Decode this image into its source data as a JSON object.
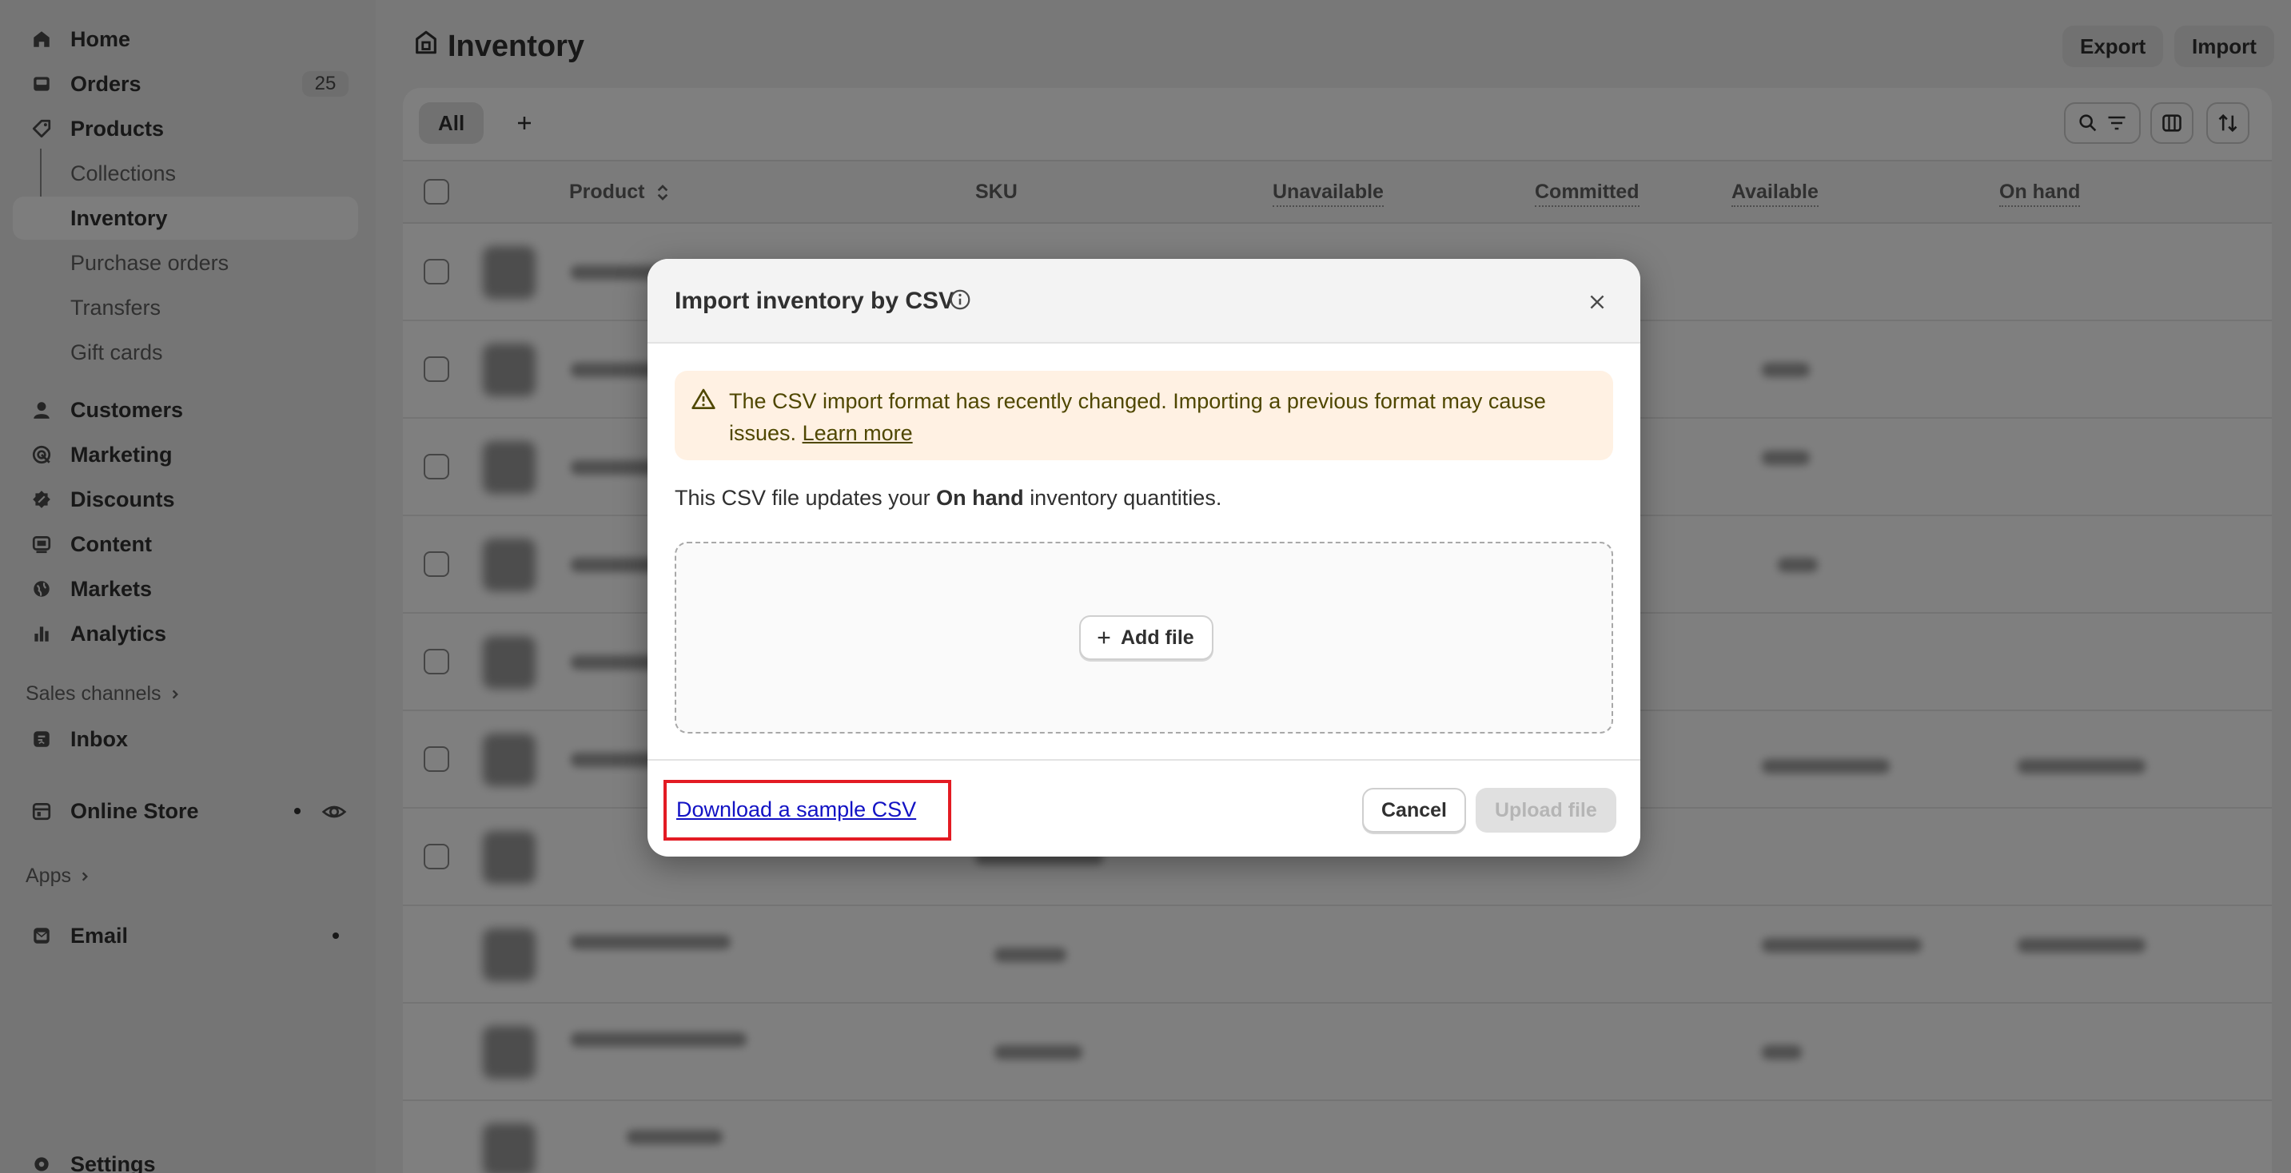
{
  "sidebar": {
    "items": [
      {
        "label": "Home",
        "icon": "home-icon"
      },
      {
        "label": "Orders",
        "icon": "inbox-tray-icon",
        "badge": "25"
      },
      {
        "label": "Products",
        "icon": "tag-icon"
      },
      {
        "label": "Collections"
      },
      {
        "label": "Inventory"
      },
      {
        "label": "Purchase orders"
      },
      {
        "label": "Transfers"
      },
      {
        "label": "Gift cards"
      },
      {
        "label": "Customers",
        "icon": "person-icon"
      },
      {
        "label": "Marketing",
        "icon": "target-icon"
      },
      {
        "label": "Discounts",
        "icon": "discount-icon"
      },
      {
        "label": "Content",
        "icon": "content-icon"
      },
      {
        "label": "Markets",
        "icon": "globe-icon"
      },
      {
        "label": "Analytics",
        "icon": "bar-chart-icon"
      }
    ],
    "sales_channels_label": "Sales channels",
    "inbox_label": "Inbox",
    "online_store_label": "Online Store",
    "apps_label": "Apps",
    "email_label": "Email",
    "settings_label": "Settings"
  },
  "header": {
    "title": "Inventory",
    "export_label": "Export",
    "import_label": "Import"
  },
  "table": {
    "tab_all": "All",
    "columns": [
      "Product",
      "SKU",
      "Unavailable",
      "Committed",
      "Available",
      "On hand"
    ]
  },
  "modal": {
    "title": "Import inventory by CSV",
    "banner_text": "The CSV import format has recently changed. Importing a previous format may cause issues.",
    "banner_link": "Learn more",
    "desc_prefix": "This CSV file updates your",
    "desc_bold": "On hand",
    "desc_suffix": "inventory quantities.",
    "add_file_label": "Add file",
    "sample_link": "Download a sample CSV",
    "cancel_label": "Cancel",
    "upload_label": "Upload file"
  },
  "colors": {
    "highlight_box": "#e31b23",
    "link": "#1212c4",
    "banner_bg": "#fff1e3"
  }
}
